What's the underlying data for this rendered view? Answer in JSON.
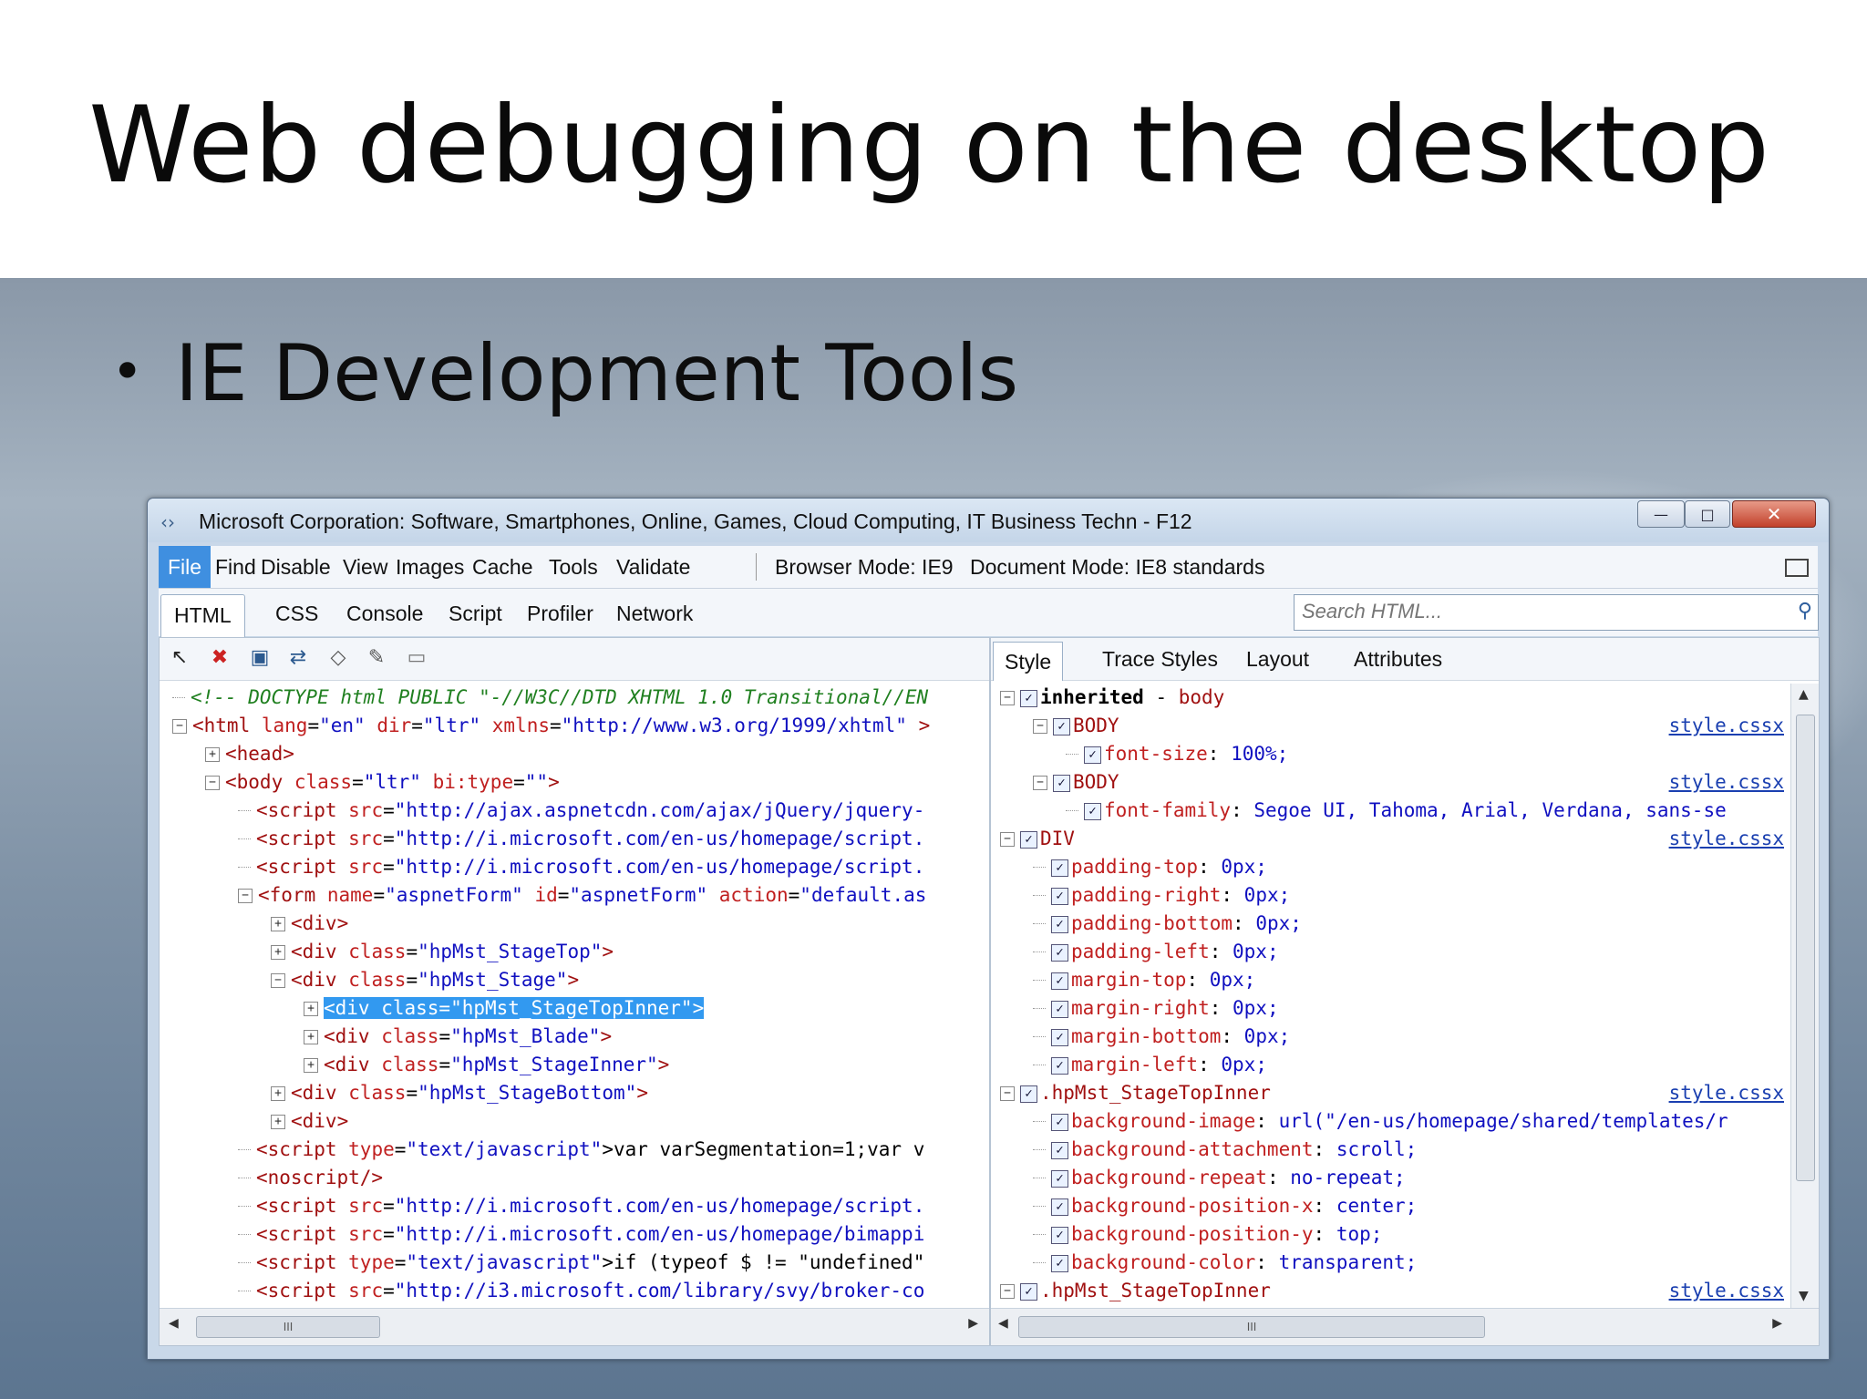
{
  "slide": {
    "title": "Web debugging on the desktop",
    "bullet": "IE Development Tools"
  },
  "window": {
    "title": "Microsoft Corporation: Software, Smartphones, Online, Games, Cloud Computing, IT Business Techn - F12",
    "min_label": "—",
    "max_label": "□",
    "close_label": "✕"
  },
  "menu": {
    "file": "File",
    "find": "Find",
    "disable": "Disable",
    "view": "View",
    "images": "Images",
    "cache": "Cache",
    "tools": "Tools",
    "validate": "Validate",
    "browser_mode": "Browser Mode: IE9",
    "document_mode": "Document Mode: IE8 standards"
  },
  "tabs": {
    "html": "HTML",
    "css": "CSS",
    "console": "Console",
    "script": "Script",
    "profiler": "Profiler",
    "network": "Network"
  },
  "search": {
    "placeholder": "Search HTML..."
  },
  "tree": [
    [
      "<!-- DOCTYPE html PUBLIC \"-//W3C//DTD XHTML 1.0 Transitional//EN"
    ],
    [
      "<html",
      " lang",
      "=",
      "\"en\"",
      " dir",
      "=",
      "\"ltr\"",
      " xmlns",
      "=",
      "\"http://www.w3.org/1999/xhtml\"",
      " >"
    ],
    [
      "<head>"
    ],
    [
      "<body",
      " class",
      "=",
      "\"ltr\"",
      " bi:type",
      "=",
      "\"\"",
      ">"
    ],
    [
      "<script",
      " src",
      "=",
      "\"http://ajax.aspnetcdn.com/ajax/jQuery/jquery-"
    ],
    [
      "<script",
      " src",
      "=",
      "\"http://i.microsoft.com/en-us/homepage/script."
    ],
    [
      "<script",
      " src",
      "=",
      "\"http://i.microsoft.com/en-us/homepage/script."
    ],
    [
      "<form",
      " name",
      "=",
      "\"aspnetForm\"",
      " id",
      "=",
      "\"aspnetForm\"",
      " action",
      "=",
      "\"default.as"
    ],
    [
      "<div>"
    ],
    [
      "<div",
      " class",
      "=",
      "\"hpMst_StageTop\"",
      ">"
    ],
    [
      "<div",
      " class",
      "=",
      "\"hpMst_Stage\"",
      ">"
    ],
    [
      "<div class=\"hpMst_StageTopInner\">"
    ],
    [
      "<div",
      " class",
      "=",
      "\"hpMst_Blade\"",
      ">"
    ],
    [
      "<div",
      " class",
      "=",
      "\"hpMst_StageInner\"",
      ">"
    ],
    [
      "<div",
      " class",
      "=",
      "\"hpMst_StageBottom\"",
      ">"
    ],
    [
      "<div>"
    ],
    [
      "<script",
      " type",
      "=",
      "\"text/javascript\"",
      ">var varSegmentation=1;var v"
    ],
    [
      "<noscript/>"
    ],
    [
      "<script",
      " src",
      "=",
      "\"http://i.microsoft.com/en-us/homepage/script."
    ],
    [
      "<script",
      " src",
      "=",
      "\"http://i.microsoft.com/en-us/homepage/bimappi"
    ],
    [
      "<script",
      " type",
      "=",
      "\"text/javascript\"",
      ">if (typeof $ != \"undefined\""
    ],
    [
      "<script",
      " src",
      "=",
      "\"http://i3.microsoft.com/library/svy/broker-co"
    ]
  ],
  "right_tabs": {
    "style": "Style",
    "trace": "Trace Styles",
    "layout": "Layout",
    "attributes": "Attributes"
  },
  "styles": {
    "inherited": "inherited",
    "inherited_sep": " - ",
    "inherited_el": "body",
    "body1_sel": "BODY",
    "body1_src": "style.cssx",
    "fs_prop": "font-size",
    "fs_val": "100%;",
    "body2_sel": "BODY",
    "body2_src": "style.cssx",
    "ff_prop": "font-family",
    "ff_val": "Segoe UI, Tahoma, Arial, Verdana, sans-se",
    "div_sel": "DIV",
    "div_src": "style.cssx",
    "div_props": [
      [
        "padding-top",
        "0px;"
      ],
      [
        "padding-right",
        "0px;"
      ],
      [
        "padding-bottom",
        "0px;"
      ],
      [
        "padding-left",
        "0px;"
      ],
      [
        "margin-top",
        "0px;"
      ],
      [
        "margin-right",
        "0px;"
      ],
      [
        "margin-bottom",
        "0px;"
      ],
      [
        "margin-left",
        "0px;"
      ]
    ],
    "hp1_sel": ".hpMst_StageTopInner",
    "hp1_src": "style.cssx",
    "hp1_props": [
      [
        "background-image",
        "url(\"/en-us/homepage/shared/templates/r"
      ],
      [
        "background-attachment",
        "scroll;"
      ],
      [
        "background-repeat",
        "no-repeat;"
      ],
      [
        "background-position-x",
        "center;"
      ],
      [
        "background-position-y",
        "top;"
      ],
      [
        "background-color",
        "transparent;"
      ]
    ],
    "hp2_sel": ".hpMst_StageTopInner",
    "hp2_src": "style.cssx"
  },
  "scroll": {
    "grip": "III"
  }
}
